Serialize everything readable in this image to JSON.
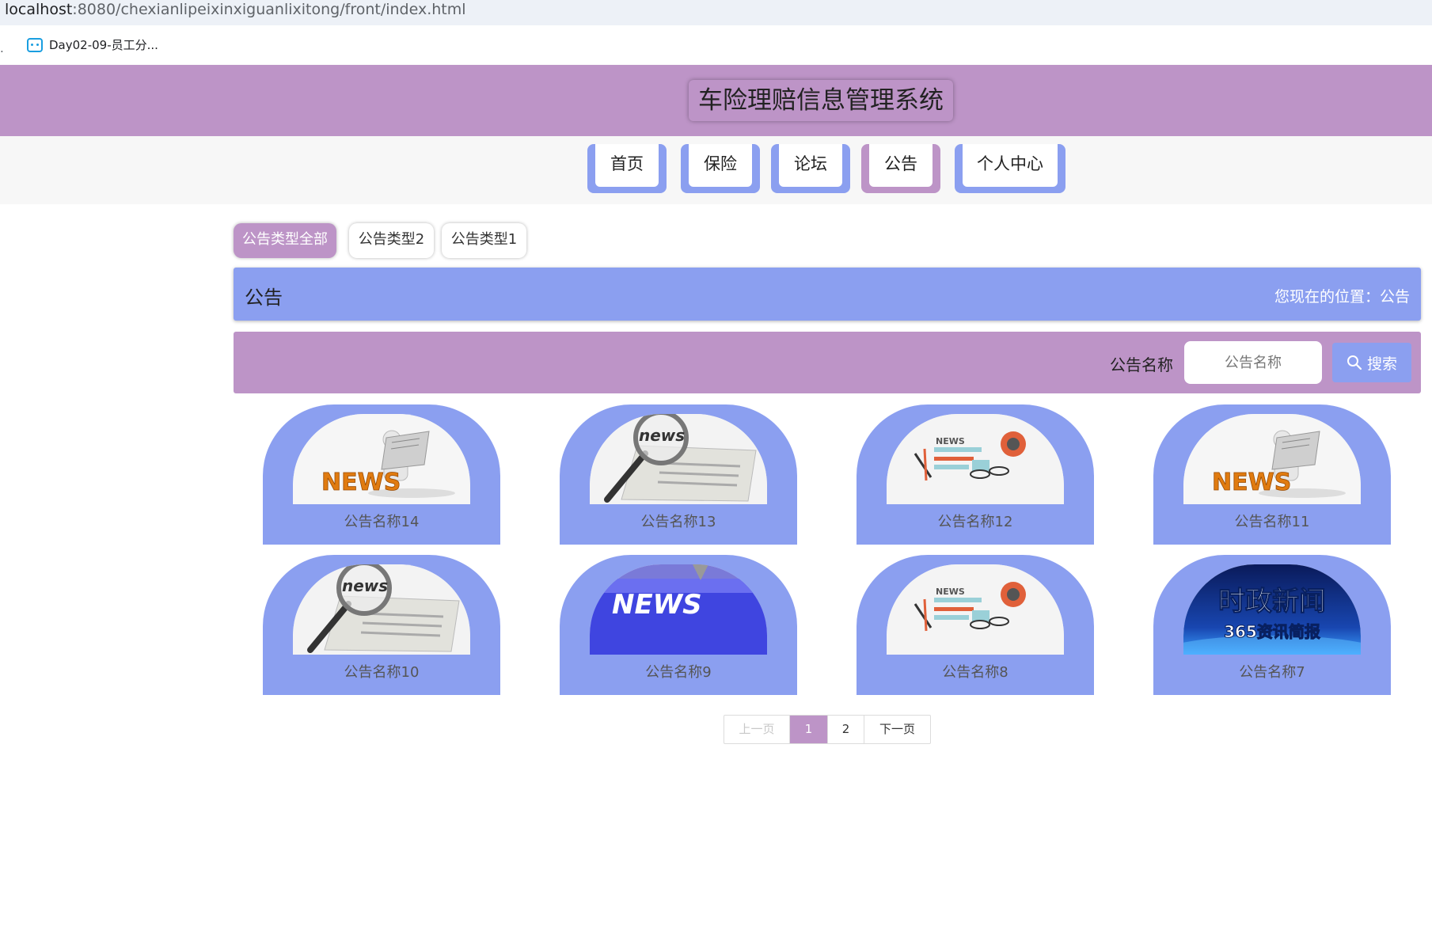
{
  "browser": {
    "url_host": "localhost",
    "url_path": ":8080/chexianlipeixinxiguanlixitong/front/index.html",
    "bookmark_left": ".",
    "bookmark_label": "Day02-09-员工分..."
  },
  "header": {
    "title": "车险理赔信息管理系统"
  },
  "nav": {
    "items": [
      {
        "label": "首页"
      },
      {
        "label": "保险"
      },
      {
        "label": "论坛"
      },
      {
        "label": "公告"
      },
      {
        "label": "个人中心"
      }
    ],
    "active": "公告"
  },
  "types": [
    {
      "label": "公告类型全部",
      "active": true
    },
    {
      "label": "公告类型2",
      "active": false
    },
    {
      "label": "公告类型1",
      "active": false
    }
  ],
  "title_bar": {
    "title": "公告",
    "location": "您现在的位置：公告"
  },
  "search": {
    "label": "公告名称",
    "placeholder": "公告名称",
    "button": "搜索"
  },
  "cards": [
    {
      "name": "公告名称14",
      "image": "news-man"
    },
    {
      "name": "公告名称13",
      "image": "news-magnifier"
    },
    {
      "name": "公告名称12",
      "image": "news-paper"
    },
    {
      "name": "公告名称11",
      "image": "news-man"
    },
    {
      "name": "公告名称10",
      "image": "news-magnifier"
    },
    {
      "name": "公告名称9",
      "image": "news-key"
    },
    {
      "name": "公告名称8",
      "image": "news-paper"
    },
    {
      "name": "公告名称7",
      "image": "political-news"
    }
  ],
  "images": {
    "political_title": "时政新闻",
    "political_sub": "365资讯简报",
    "news_word": "NEWS",
    "news_word_lower": "news"
  },
  "pagination": {
    "prev": "上一页",
    "pages": [
      "1",
      "2"
    ],
    "current": "1",
    "next": "下一页"
  },
  "colors": {
    "purple": "#bd94c7",
    "blue": "#8b9ff0"
  }
}
